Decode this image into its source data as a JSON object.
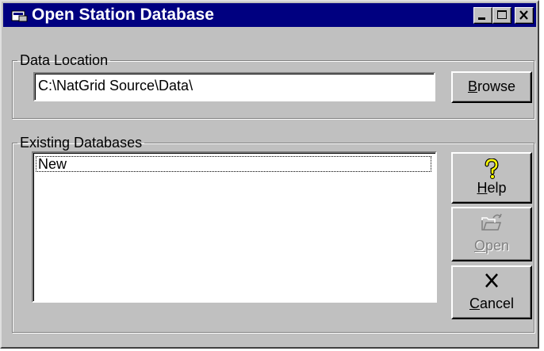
{
  "window": {
    "title": "Open Station Database",
    "controls": {
      "minimize": "minimize-icon",
      "maximize": "maximize-icon",
      "close": "close-icon"
    }
  },
  "data_location": {
    "group_label": "Data Location",
    "path_value": "C:\\NatGrid Source\\Data\\",
    "browse_button": {
      "mnemonic": "B",
      "rest": "rowse"
    }
  },
  "existing_databases": {
    "group_label": "Existing Databases",
    "items": [
      "New"
    ],
    "selected_index": 0
  },
  "buttons": {
    "help": {
      "mnemonic": "H",
      "rest": "elp",
      "icon": "question-mark-icon",
      "enabled": true
    },
    "open": {
      "mnemonic": "O",
      "rest": "pen",
      "icon": "open-folder-icon",
      "enabled": false
    },
    "cancel": {
      "mnemonic": "C",
      "rest": "ancel",
      "icon": "x-cancel-icon",
      "enabled": true
    }
  },
  "colors": {
    "titlebar": "#000080",
    "face": "#c0c0c0",
    "disabled_text": "#808080",
    "help_icon": "#ffff00"
  }
}
